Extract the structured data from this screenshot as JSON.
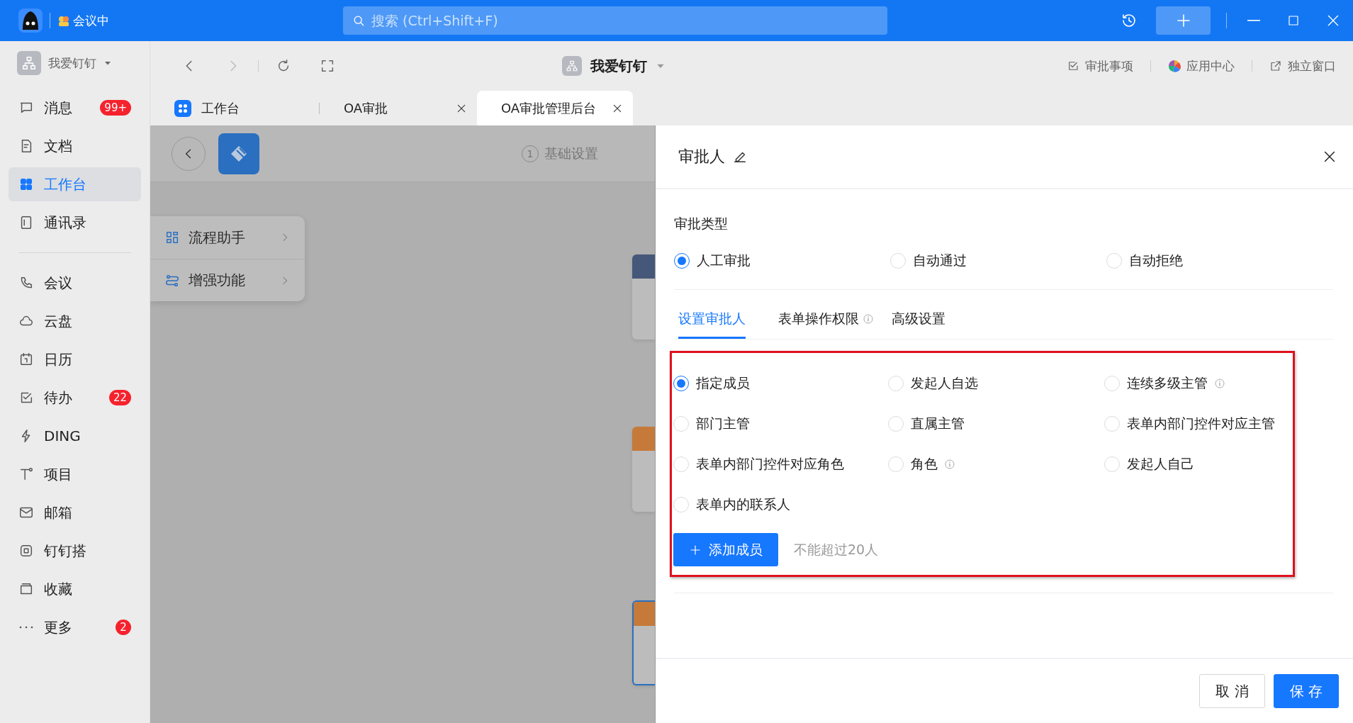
{
  "titlebar": {
    "status": "会议中",
    "search": {
      "placeholder": "搜索 (Ctrl+Shift+F)"
    }
  },
  "sidebar": {
    "org": "我爱钉钉",
    "sections": [
      [
        {
          "label": "消息",
          "badge": "99+",
          "selected": false
        },
        {
          "label": "文档",
          "selected": false
        },
        {
          "label": "工作台",
          "selected": true
        },
        {
          "label": "通讯录",
          "selected": false
        }
      ],
      [
        {
          "label": "会议",
          "selected": false
        },
        {
          "label": "云盘",
          "selected": false
        },
        {
          "label": "日历",
          "selected": false
        },
        {
          "label": "待办",
          "badge": "22",
          "selected": false
        },
        {
          "label": "DING",
          "selected": false
        },
        {
          "label": "项目",
          "selected": false
        },
        {
          "label": "邮箱",
          "selected": false
        },
        {
          "label": "钉钉搭",
          "selected": false
        },
        {
          "label": "收藏",
          "selected": false
        },
        {
          "label": "更多",
          "badge": "2",
          "selected": false
        }
      ]
    ]
  },
  "toolbar": {
    "org": "我爱钉钉",
    "links": [
      "审批事项",
      "应用中心",
      "独立窗口"
    ]
  },
  "tabs": [
    {
      "label": "工作台",
      "selected": false,
      "closable": false
    },
    {
      "label": "OA审批",
      "selected": false,
      "closable": true
    },
    {
      "label": "OA审批管理后台",
      "selected": true,
      "closable": true
    }
  ],
  "page": {
    "step": "1",
    "step_label": "基础设置",
    "menu": [
      "流程助手",
      "增强功能"
    ]
  },
  "drawer": {
    "title": "审批人",
    "type_label": "审批类型",
    "approval_types": [
      {
        "label": "人工审批",
        "selected": true
      },
      {
        "label": "自动通过",
        "selected": false
      },
      {
        "label": "自动拒绝",
        "selected": false
      }
    ],
    "subtabs": [
      {
        "label": "设置审批人",
        "selected": true,
        "info": false
      },
      {
        "label": "表单操作权限",
        "selected": false,
        "info": true
      },
      {
        "label": "高级设置",
        "selected": false,
        "info": false
      }
    ],
    "approver_options": [
      {
        "label": "指定成员",
        "selected": true,
        "info": false
      },
      {
        "label": "发起人自选",
        "selected": false,
        "info": false
      },
      {
        "label": "连续多级主管",
        "selected": false,
        "info": true
      },
      {
        "label": "部门主管",
        "selected": false,
        "info": false
      },
      {
        "label": "直属主管",
        "selected": false,
        "info": false
      },
      {
        "label": "表单内部门控件对应主管",
        "selected": false,
        "info": false
      },
      {
        "label": "表单内部门控件对应角色",
        "selected": false,
        "info": false
      },
      {
        "label": "角色",
        "selected": false,
        "info": true
      },
      {
        "label": "发起人自己",
        "selected": false,
        "info": false
      },
      {
        "label": "表单内的联系人",
        "selected": false,
        "info": false
      }
    ],
    "add_button": "添加成员",
    "limit_note": "不能超过20人",
    "cancel": "取 消",
    "save": "保 存"
  }
}
